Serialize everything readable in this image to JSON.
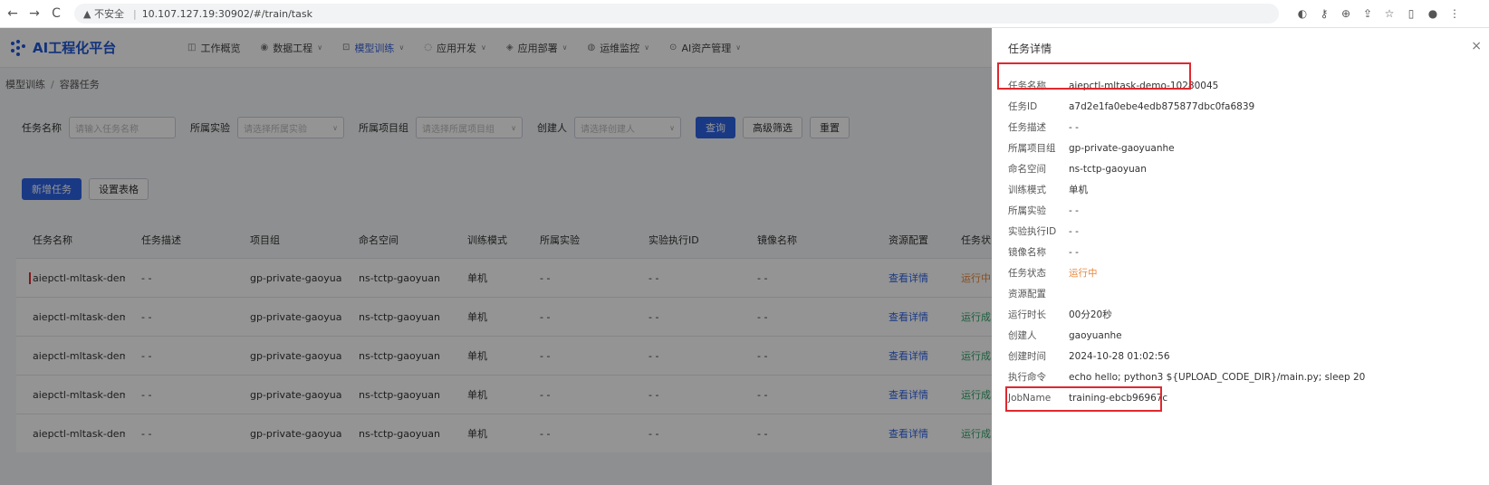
{
  "browser": {
    "back": "←",
    "forward": "→",
    "reload": "C",
    "insecure": "▲ 不安全",
    "url": "10.107.127.19:30902/#/train/task",
    "icons": [
      "translate-icon",
      "key-icon",
      "zoom-icon",
      "share-icon",
      "star-icon",
      "sidebar-icon",
      "profile-icon",
      "more-icon"
    ]
  },
  "app": {
    "logo": "AI工程化平台",
    "menu": [
      {
        "label": "工作概览",
        "icon": "◫",
        "caret": ""
      },
      {
        "label": "数据工程",
        "icon": "◉",
        "caret": "∨"
      },
      {
        "label": "模型训练",
        "icon": "⊡",
        "caret": "∨",
        "active": true
      },
      {
        "label": "应用开发",
        "icon": "◌",
        "caret": "∨"
      },
      {
        "label": "应用部署",
        "icon": "◈",
        "caret": "∨"
      },
      {
        "label": "运维监控",
        "icon": "◍",
        "caret": "∨"
      },
      {
        "label": "AI资产管理",
        "icon": "⊙",
        "caret": "∨"
      }
    ],
    "breadcrumb": [
      "模型训练",
      "容器任务"
    ]
  },
  "filters": {
    "task_name_label": "任务名称",
    "task_name_placeholder": "请输入任务名称",
    "experiment_label": "所属实验",
    "experiment_placeholder": "请选择所属实验",
    "project_label": "所属项目组",
    "project_placeholder": "请选择所属项目组",
    "creator_label": "创建人",
    "creator_placeholder": "请选择创建人",
    "query_btn": "查询",
    "advanced_btn": "高级筛选",
    "reset_btn": "重置"
  },
  "actions": {
    "new_task": "新增任务",
    "settings": "设置表格"
  },
  "table": {
    "headers": [
      "任务名称",
      "任务描述",
      "项目组",
      "命名空间",
      "训练模式",
      "所属实验",
      "实验执行ID",
      "镜像名称",
      "资源配置",
      "任务状"
    ],
    "rows": [
      {
        "name": "aiepctl-mltask-dem...",
        "desc": "- -",
        "group": "gp-private-gaoyua...",
        "ns": "ns-tctp-gaoyuan",
        "mode": "单机",
        "exp": "- -",
        "exp_id": "- -",
        "image": "- -",
        "res": "查看详情",
        "status": "运行中",
        "status_type": "run"
      },
      {
        "name": "aiepctl-mltask-dem...",
        "desc": "- -",
        "group": "gp-private-gaoyua...",
        "ns": "ns-tctp-gaoyuan",
        "mode": "单机",
        "exp": "- -",
        "exp_id": "- -",
        "image": "- -",
        "res": "查看详情",
        "status": "运行成",
        "status_type": "done"
      },
      {
        "name": "aiepctl-mltask-dem...",
        "desc": "- -",
        "group": "gp-private-gaoyua...",
        "ns": "ns-tctp-gaoyuan",
        "mode": "单机",
        "exp": "- -",
        "exp_id": "- -",
        "image": "- -",
        "res": "查看详情",
        "status": "运行成",
        "status_type": "done"
      },
      {
        "name": "aiepctl-mltask-dem...",
        "desc": "- -",
        "group": "gp-private-gaoyua...",
        "ns": "ns-tctp-gaoyuan",
        "mode": "单机",
        "exp": "- -",
        "exp_id": "- -",
        "image": "- -",
        "res": "查看详情",
        "status": "运行成",
        "status_type": "done"
      },
      {
        "name": "aiepctl-mltask-dem...",
        "desc": "- -",
        "group": "gp-private-gaoyua...",
        "ns": "ns-tctp-gaoyuan",
        "mode": "单机",
        "exp": "- -",
        "exp_id": "- -",
        "image": "- -",
        "res": "查看详情",
        "status": "运行成",
        "status_type": "done"
      }
    ]
  },
  "drawer": {
    "title": "任务详情",
    "close": "×",
    "fields": [
      {
        "key": "任务名称",
        "value": "aiepctl-mltask-demo-10280045"
      },
      {
        "key": "任务ID",
        "value": "a7d2e1fa0ebe4edb875877dbc0fa6839"
      },
      {
        "key": "任务描述",
        "value": "- -"
      },
      {
        "key": "所属项目组",
        "value": "gp-private-gaoyuanhe"
      },
      {
        "key": "命名空间",
        "value": "ns-tctp-gaoyuan"
      },
      {
        "key": "训练模式",
        "value": "单机"
      },
      {
        "key": "所属实验",
        "value": "- -"
      },
      {
        "key": "实验执行ID",
        "value": "- -"
      },
      {
        "key": "镜像名称",
        "value": "- -"
      },
      {
        "key": "任务状态",
        "value": "运行中",
        "type": "run"
      },
      {
        "key": "资源配置",
        "value": ""
      },
      {
        "key": "运行时长",
        "value": "00分20秒"
      },
      {
        "key": "创建人",
        "value": "gaoyuanhe"
      },
      {
        "key": "创建时间",
        "value": "2024-10-28 01:02:56"
      },
      {
        "key": "执行命令",
        "value": "echo hello; python3 ${UPLOAD_CODE_DIR}/main.py; sleep 20"
      },
      {
        "key": "JobName",
        "value": "training-ebcb96967c"
      }
    ]
  },
  "colors": {
    "primary": "#2d63e6",
    "running": "#e8873a",
    "success": "#2fa36a",
    "highlight": "#e0282e"
  }
}
